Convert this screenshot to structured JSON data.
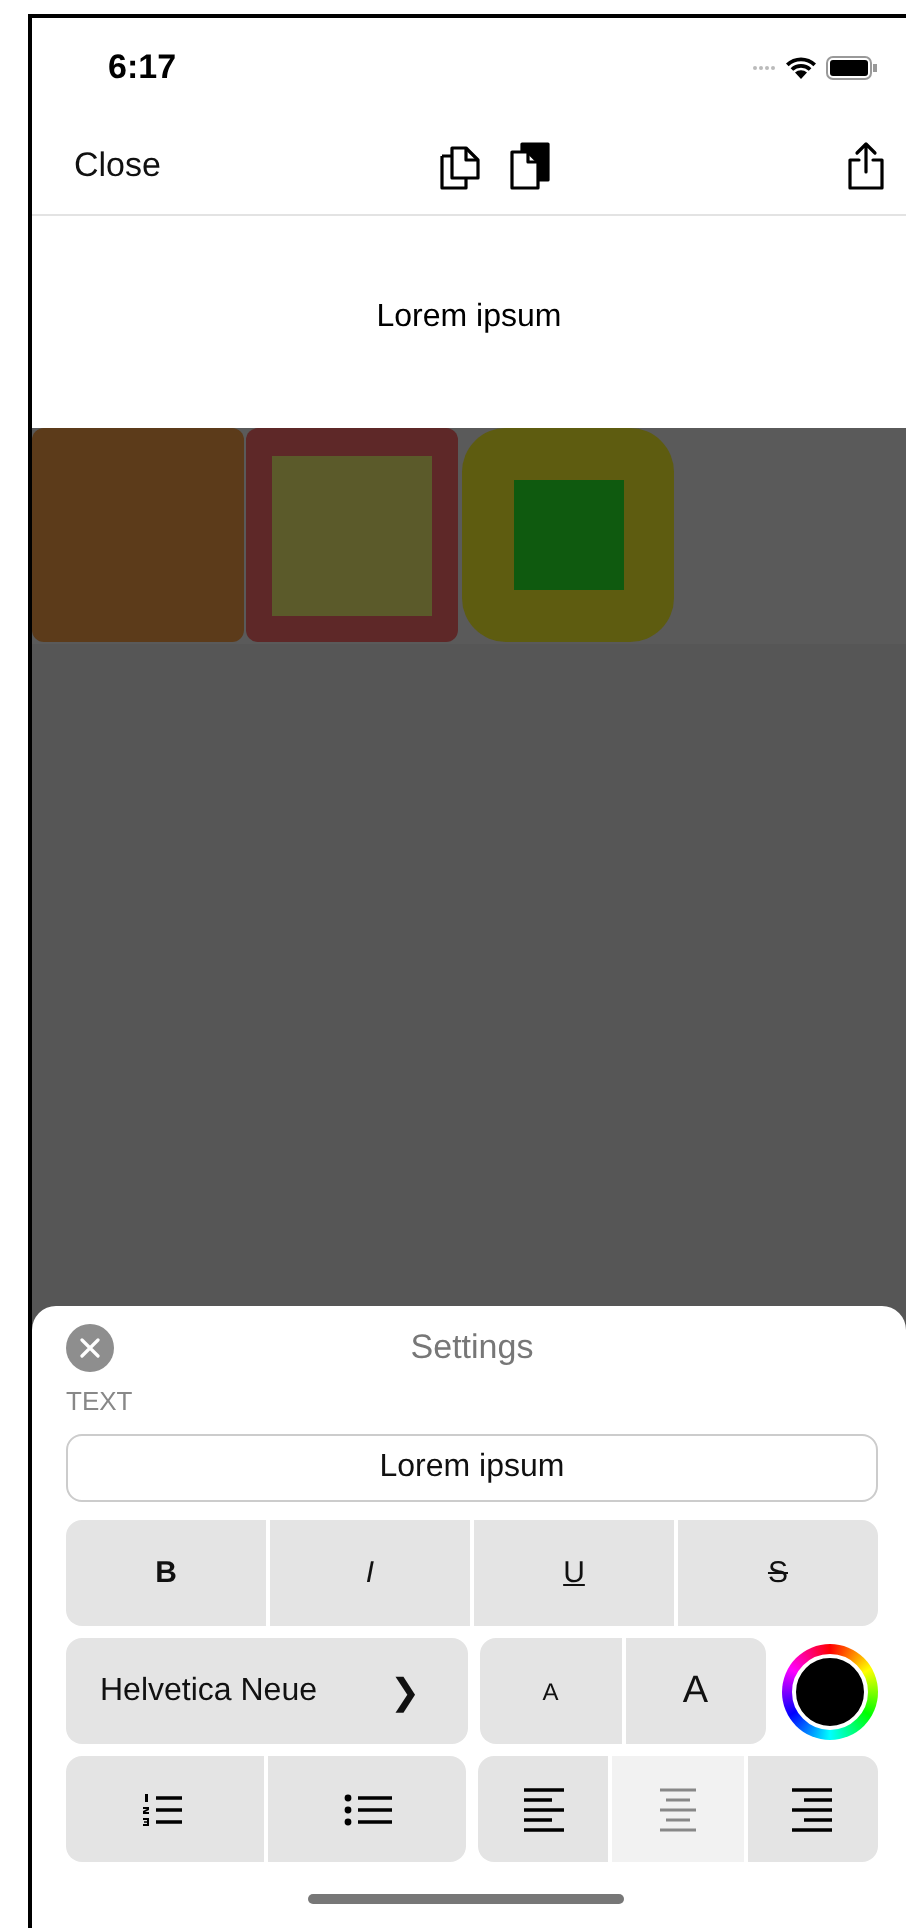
{
  "status_bar": {
    "time": "6:17"
  },
  "nav_bar": {
    "close": "Close"
  },
  "canvas": {
    "text": "Lorem ipsum"
  },
  "shapes": [
    {
      "kind": "filled",
      "color": "#5c3b1a"
    },
    {
      "kind": "framed",
      "color": "#5e2828",
      "inner": {
        "color": "#5b5a2a"
      }
    },
    {
      "kind": "rounded",
      "color": "#5e5c10",
      "inner": {
        "color": "#0f5a0f"
      }
    }
  ],
  "settings": {
    "title": "Settings",
    "section": "TEXT",
    "text_value": "Lorem ipsum",
    "styles": [
      {
        "kind": "bold",
        "label": "B"
      },
      {
        "kind": "italic",
        "label": "I"
      },
      {
        "kind": "underline",
        "label": "U"
      },
      {
        "kind": "strike",
        "label": "S"
      }
    ],
    "font": {
      "name": "Helvetica Neue",
      "chevron": "❯"
    },
    "size_buttons": [
      {
        "kind": "smaller",
        "label": "A"
      },
      {
        "kind": "larger",
        "label": "A"
      }
    ],
    "color_well": {
      "color": "#000000"
    },
    "lists": [
      {
        "kind": "numbered"
      },
      {
        "kind": "bulleted"
      }
    ],
    "alignment": [
      {
        "kind": "left",
        "selected": false
      },
      {
        "kind": "center",
        "selected": true
      },
      {
        "kind": "right",
        "selected": false
      }
    ]
  }
}
